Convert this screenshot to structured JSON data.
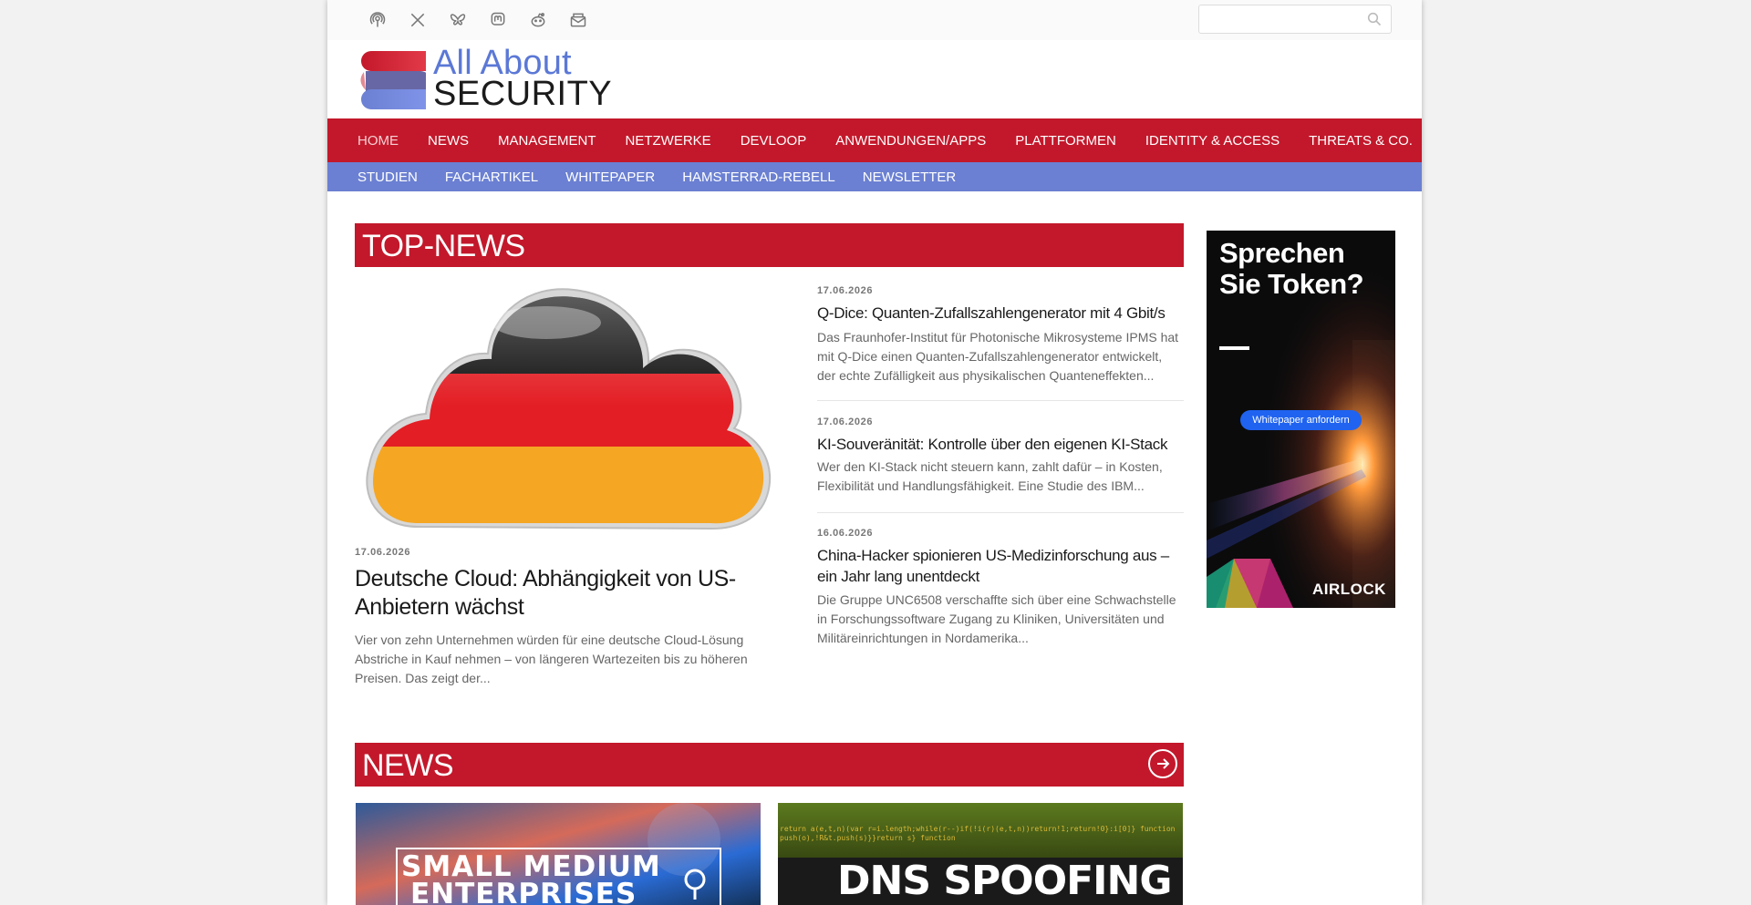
{
  "search": {
    "placeholder": ""
  },
  "logo": {
    "line1": "All About",
    "line2": "SECURITY"
  },
  "nav_main": [
    "HOME",
    "NEWS",
    "MANAGEMENT",
    "NETZWERKE",
    "DEVLOOP",
    "ANWENDUNGEN/APPS",
    "PLATTFORMEN",
    "IDENTITY & ACCESS",
    "THREATS & CO."
  ],
  "nav_sub": [
    "STUDIEN",
    "FACHARTIKEL",
    "WHITEPAPER",
    "HAMSTERRAD-REBELL",
    "NEWSLETTER"
  ],
  "top_news": {
    "heading": "TOP-NEWS",
    "featured": {
      "date": "17.06.2026",
      "title": "Deutsche Cloud: Abhängigkeit von US-Anbietern wächst",
      "excerpt": "Vier von zehn Unternehmen würden für eine deutsche Cloud-Lösung Abstriche in Kauf nehmen – von längeren Wartezeiten bis zu höheren Preisen. Das zeigt der..."
    },
    "items": [
      {
        "date": "17.06.2026",
        "title": "Q-Dice: Quanten-Zufallszahlengenerator mit 4 Gbit/s",
        "excerpt": "Das Fraunhofer-Institut für Photonische Mikrosysteme IPMS hat mit Q-Dice einen Quanten-Zufallszahlengenerator entwickelt, der echte Zufälligkeit aus physikalischen Quanteneffekten..."
      },
      {
        "date": "17.06.2026",
        "title": "KI-Souveränität: Kontrolle über den eigenen KI-Stack",
        "excerpt": "Wer den KI-Stack nicht steuern kann, zahlt dafür – in Kosten, Flexibilität und Handlungsfähigkeit. Eine Studie des IBM..."
      },
      {
        "date": "16.06.2026",
        "title": "China-Hacker spionieren US-Medizinforschung aus – ein Jahr lang unentdeckt",
        "excerpt": "Die Gruppe UNC6508 verschaffte sich über eine Schwachstelle in Forschungssoftware Zugang zu Kliniken, Universitäten und Militäreinrichtungen in Nordamerika..."
      }
    ]
  },
  "ad": {
    "title": "Sprechen Sie Token?",
    "button": "Whitepaper anfordern",
    "brand": "AIRLOCK"
  },
  "news": {
    "heading": "NEWS",
    "thumb1": {
      "line1": "SMALL MEDIUM",
      "line2": "ENTERPRISES"
    },
    "thumb2": {
      "line1": "DNS SPOOFING",
      "code": "return a(e,t,n)(var r=i.length;while(r--)if(!i(r)(e,t,n))return!1;return!0}:i[0]} function push(o),!R&t.push(s)}}return s} function"
    }
  },
  "colors": {
    "red": "#c3182b",
    "blue": "#6b80d2",
    "ad_button": "#1f63f0"
  }
}
